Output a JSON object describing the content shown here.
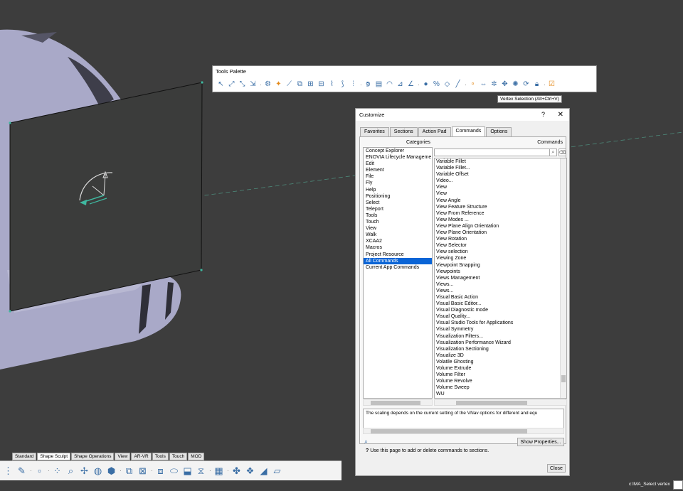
{
  "tools_palette": {
    "title": "Tools Palette",
    "icons": [
      "select-icon",
      "snap-icon",
      "measure-icon",
      "compass-icon",
      "robot-icon",
      "arm-icon",
      "manipulator-icon",
      "gizmo-icon",
      "axis-icon",
      "path-icon",
      "curve-icon",
      "grid-icon",
      "frame-icon",
      "arc-icon",
      "angle-icon",
      "sphere-icon",
      "percent-icon",
      "diamond-icon",
      "line-icon",
      "dot-icon",
      "move-icon",
      "rotate-icon",
      "pan-icon",
      "target-icon",
      "cycle-icon",
      "lock-icon",
      "vertex-select-icon"
    ],
    "tooltip": "Vertex Selection (Alt+Ctrl+V)"
  },
  "dialog": {
    "title": "Customize",
    "help": "?",
    "close_glyph": "✕",
    "tabs": [
      {
        "label": "Favorites"
      },
      {
        "label": "Sections"
      },
      {
        "label": "Action Pad"
      },
      {
        "label": "Commands"
      },
      {
        "label": "Options"
      }
    ],
    "categories_header": "Categories",
    "commands_header": "Commands",
    "categories": [
      "Concept Explorer",
      "ENOVIA Lifecycle Manageme",
      "Edit",
      "Element",
      "File",
      "Fly",
      "Help",
      "Positioning",
      "Select",
      "Teleport",
      "Tools",
      "Touch",
      "View",
      "Walk",
      "XCAA2",
      "Macros",
      "Project Resource",
      "All Commands",
      "Current App Commands"
    ],
    "selected_category": "All Commands",
    "search_value": "",
    "commands": [
      "Variable Fillet",
      "Variable Fillet...",
      "Variable Offset",
      "Video...",
      "View",
      "View",
      "View Angle",
      "View Feature Structure",
      "View From Reference",
      "View Modes ...",
      "View Plane Align Orientation",
      "View Plane Orientation",
      "View Rotation",
      "View Selector",
      "View selection",
      "Viewing Zone",
      "Viewpoint Snapping",
      "Viewpoints",
      "Views Management",
      "Views...",
      "Views...",
      "Visual Basic Action",
      "Visual Basic Editor...",
      "Visual Diagnostic mode",
      "Visual Quality...",
      "Visual Studio Tools for Applications",
      "Visual Symmetry",
      "Visualization Filters...",
      "Visualization Performance Wizard",
      "Visualization Sectioning",
      "Visualize 3D",
      "Volatile Ghosting",
      "Volume Extrude",
      "Volume Filter",
      "Volume Revolve",
      "Volume Sweep",
      "WU"
    ],
    "description": "The scaling depends on the current setting of the VNav options for different and equ",
    "show_properties": "Show Properties...",
    "hint": "Use this page to add or delete commands to sections.",
    "close_label": "Close"
  },
  "bottom": {
    "tabs": [
      {
        "label": "Standard"
      },
      {
        "label": "Shape Sculpt"
      },
      {
        "label": "Shape Operations"
      },
      {
        "label": "View"
      },
      {
        "label": "AR-VR"
      },
      {
        "label": "Tools"
      },
      {
        "label": "Touch"
      },
      {
        "label": "MOD"
      }
    ],
    "active_tab": "Shape Sculpt"
  },
  "status": {
    "text": "c:IMA_Select vertex"
  },
  "colors": {
    "background": "#3d3d3d",
    "model_surface": "#a9a9c8",
    "selection": "#0a64d6",
    "axis_green": "#3fb8a0"
  }
}
